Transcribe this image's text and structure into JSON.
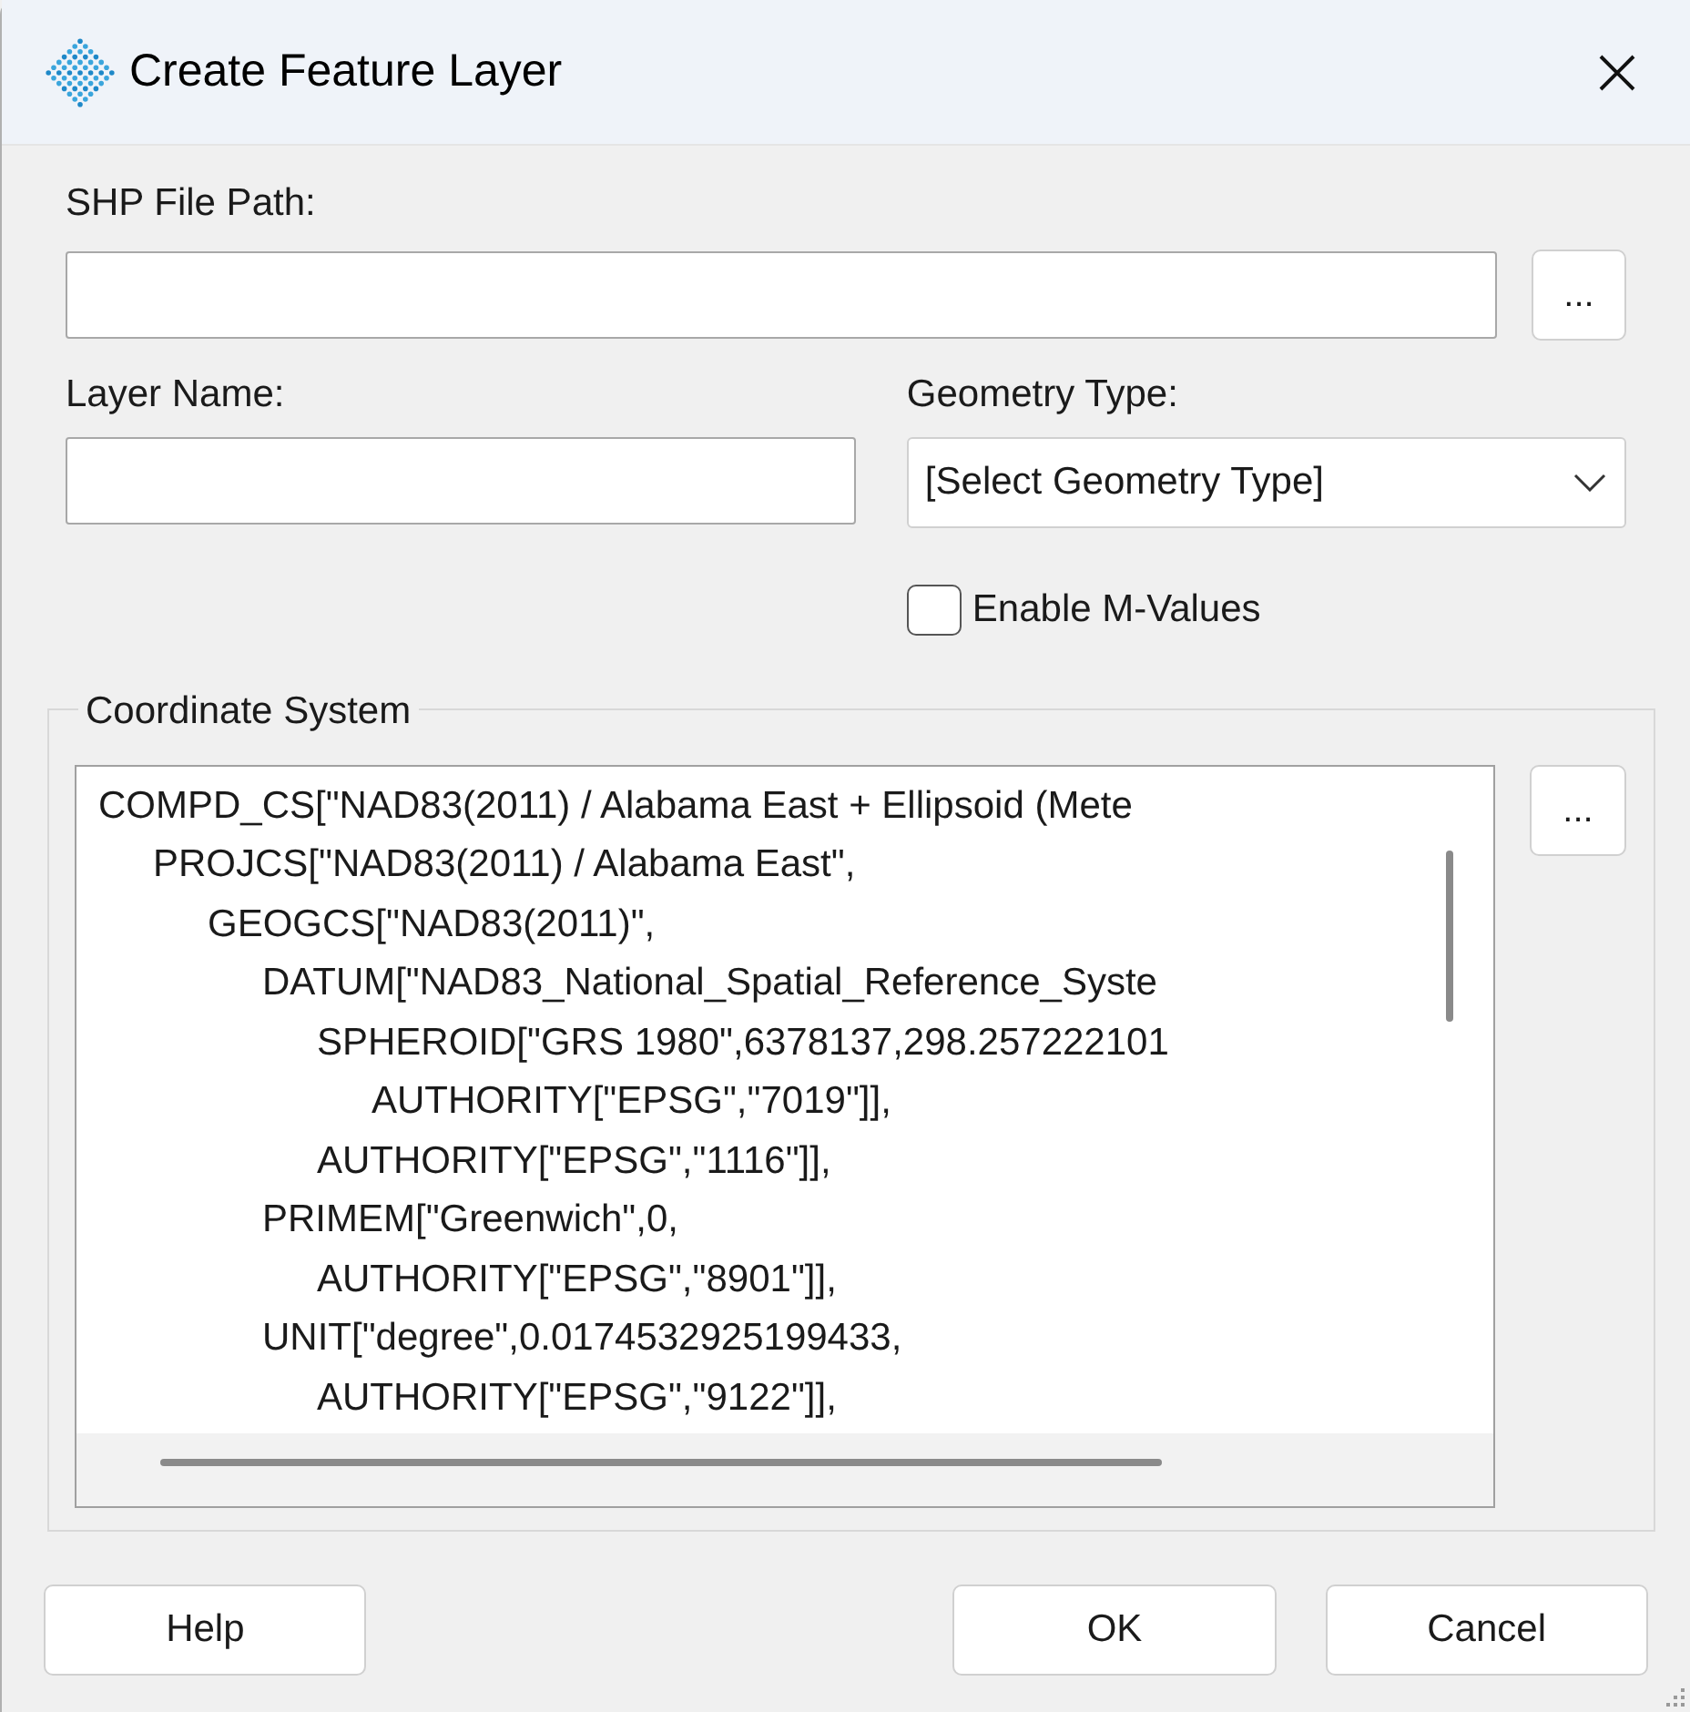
{
  "window": {
    "title": "Create Feature Layer"
  },
  "shp_file_path": {
    "label": "SHP File Path:",
    "browse": "..."
  },
  "layer_name": {
    "label": "Layer Name:"
  },
  "geometry_type": {
    "label": "Geometry Type:",
    "value": "[Select Geometry Type]"
  },
  "enable_m_values": {
    "label": "Enable M-Values",
    "checked": false
  },
  "coordinate_system": {
    "title": "Coordinate System",
    "browse": "...",
    "lines": [
      {
        "text": "COMPD_CS[\"NAD83(2011) / Alabama East + Ellipsoid (Mete",
        "children": [
          {
            "text": "PROJCS[\"NAD83(2011) / Alabama East\",",
            "children": [
              {
                "text": "GEOGCS[\"NAD83(2011)\",",
                "children": [
                  {
                    "text": "DATUM[\"NAD83_National_Spatial_Reference_Syste",
                    "children": [
                      {
                        "text": "SPHEROID[\"GRS 1980\",6378137,298.257222101",
                        "children": [
                          {
                            "text": "AUTHORITY[\"EPSG\",\"7019\"]],"
                          }
                        ]
                      },
                      {
                        "text": "AUTHORITY[\"EPSG\",\"1116\"]],"
                      }
                    ]
                  },
                  {
                    "text": "PRIMEM[\"Greenwich\",0,",
                    "children": [
                      {
                        "text": "AUTHORITY[\"EPSG\",\"8901\"]],"
                      }
                    ]
                  },
                  {
                    "text": "UNIT[\"degree\",0.0174532925199433,",
                    "children": [
                      {
                        "text": "AUTHORITY[\"EPSG\",\"9122\"]],"
                      }
                    ]
                  }
                ]
              }
            ]
          }
        ]
      }
    ]
  },
  "buttons": [
    {
      "label": "Help"
    },
    {
      "label": "OK"
    },
    {
      "label": "Cancel"
    }
  ]
}
